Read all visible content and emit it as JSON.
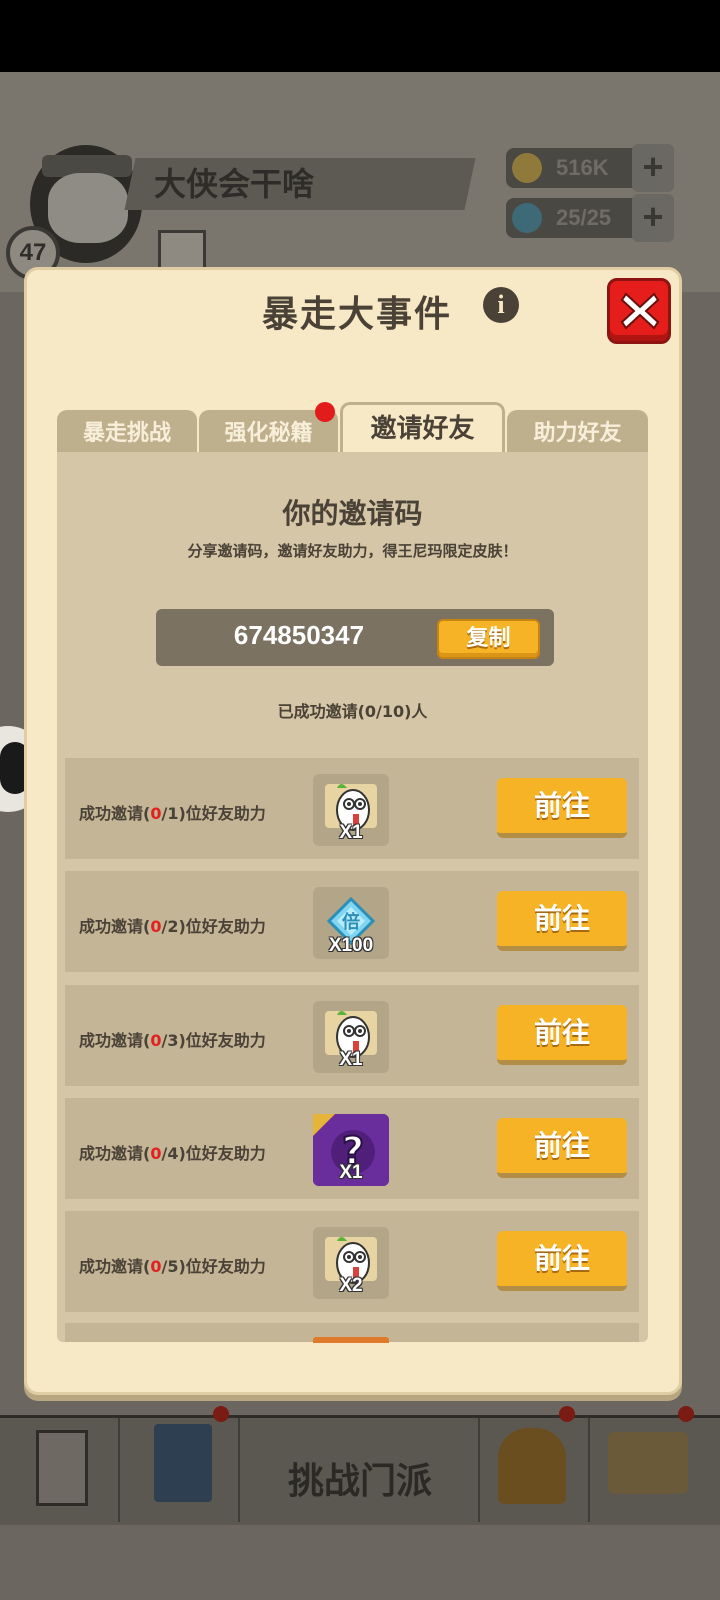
{
  "background": {
    "player": {
      "level": "47",
      "name": "大侠会干啥"
    },
    "resources": [
      {
        "icon": "coin-icon",
        "value": "516K"
      },
      {
        "icon": "energy-icon",
        "value": "25/25"
      }
    ],
    "bottom_nav": {
      "center_label": "挑战门派"
    }
  },
  "modal": {
    "title": "暴走大事件",
    "tabs": [
      {
        "label": "暴走挑战",
        "active": false
      },
      {
        "label": "强化秘籍",
        "active": false,
        "has_notification": true
      },
      {
        "label": "邀请好友",
        "active": true
      },
      {
        "label": "助力好友",
        "active": false
      }
    ],
    "invite": {
      "heading": "你的邀请码",
      "subtitle": "分享邀请码，邀请好友助力，得王尼玛限定皮肤！",
      "code": "674850347",
      "copy_label": "复制",
      "invited_count": "已成功邀请(0/10)人"
    },
    "rewards": [
      {
        "prefix": "成功邀请(",
        "current": "0",
        "target": "/1)",
        "suffix": "位好友助力",
        "item_icon": "radish-character-icon",
        "qty": "X1",
        "button": "前往"
      },
      {
        "prefix": "成功邀请(",
        "current": "0",
        "target": "/2)",
        "suffix": "位好友助力",
        "item_icon": "multiplier-diamond-icon",
        "qty": "X100",
        "button": "前往"
      },
      {
        "prefix": "成功邀请(",
        "current": "0",
        "target": "/3)",
        "suffix": "位好友助力",
        "item_icon": "radish-character-icon",
        "qty": "X1",
        "button": "前往"
      },
      {
        "prefix": "成功邀请(",
        "current": "0",
        "target": "/4)",
        "suffix": "位好友助力",
        "item_icon": "mystery-box-icon",
        "qty": "X1",
        "button": "前往"
      },
      {
        "prefix": "成功邀请(",
        "current": "0",
        "target": "/5)",
        "suffix": "位好友助力",
        "item_icon": "radish-character-icon",
        "qty": "X2",
        "button": "前往"
      }
    ]
  },
  "colors": {
    "modal_bg": "#f7e8c6",
    "button_orange": "#f6b325",
    "close_red": "#e51e1b",
    "progress_red": "#e32020"
  }
}
